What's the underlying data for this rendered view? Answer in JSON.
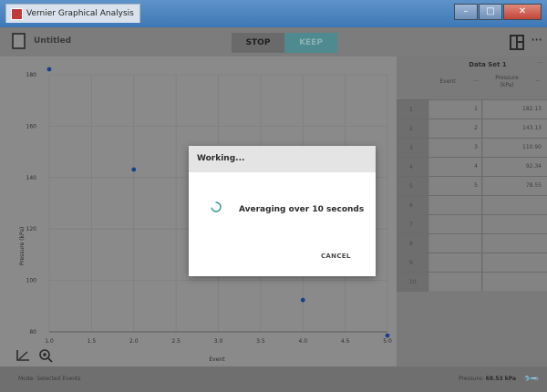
{
  "window": {
    "title": "Vernier Graphical Analysis"
  },
  "toolbar": {
    "file_title": "Untitled",
    "stop_label": "STOP",
    "keep_label": "KEEP"
  },
  "graph": {
    "ylabel": "Pressure (kPa)",
    "xlabel": "Event",
    "yticks": [
      "180",
      "160",
      "140",
      "120",
      "100",
      "80"
    ],
    "xticks": [
      "1.0",
      "1.5",
      "2.0",
      "2.5",
      "3.0",
      "3.5",
      "4.0",
      "4.5",
      "5.0"
    ]
  },
  "chart_data": {
    "type": "scatter",
    "x": [
      1,
      2,
      3,
      4,
      5
    ],
    "y": [
      182.13,
      143.13,
      110.9,
      92.34,
      78.55
    ],
    "xlabel": "Event",
    "ylabel": "Pressure (kPa)",
    "xlim": [
      1.0,
      5.0
    ],
    "ylim": [
      80,
      180
    ],
    "grid": true,
    "point_color": "#1a3f8a"
  },
  "table": {
    "title": "Data Set 1",
    "col_event": "Event",
    "col_pressure": "Pressure (kPa)",
    "menu_glyph": "···",
    "rows": [
      {
        "n": "1",
        "event": "1",
        "pressure": "182.13"
      },
      {
        "n": "2",
        "event": "2",
        "pressure": "143.13"
      },
      {
        "n": "3",
        "event": "3",
        "pressure": "110.90"
      },
      {
        "n": "4",
        "event": "4",
        "pressure": "92.34"
      },
      {
        "n": "5",
        "event": "5",
        "pressure": "78.55"
      },
      {
        "n": "6",
        "event": "",
        "pressure": ""
      },
      {
        "n": "7",
        "event": "",
        "pressure": ""
      },
      {
        "n": "8",
        "event": "",
        "pressure": ""
      },
      {
        "n": "9",
        "event": "",
        "pressure": ""
      },
      {
        "n": "10",
        "event": "",
        "pressure": ""
      }
    ]
  },
  "status": {
    "mode": "Mode: Selected Events",
    "pressure_label": "Pressure:",
    "pressure_value": "68.53 kPa"
  },
  "dialog": {
    "title": "Working...",
    "message": "Averaging over 10 seconds",
    "cancel_label": "CANCEL"
  },
  "colors": {
    "accent": "#2f8f94",
    "spinner": "#2f8f94"
  }
}
